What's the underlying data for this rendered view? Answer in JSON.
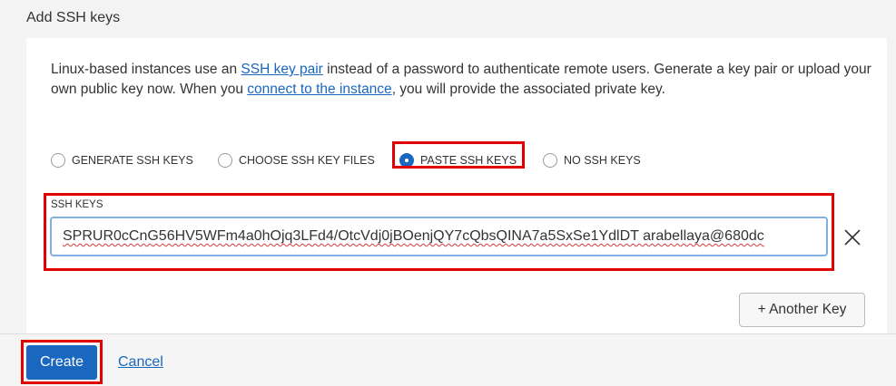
{
  "section": {
    "title": "Add SSH keys"
  },
  "description": {
    "part1": "Linux-based instances use an ",
    "link1": "SSH key pair",
    "part2": " instead of a password to authenticate remote users. Generate a key pair or upload your own public key now. When you ",
    "link2": "connect to the instance",
    "part3": ", you will provide the associated private key."
  },
  "ssh_options": [
    {
      "label": "GENERATE SSH KEYS",
      "selected": false
    },
    {
      "label": "CHOOSE SSH KEY FILES",
      "selected": false
    },
    {
      "label": "PASTE SSH KEYS",
      "selected": true
    },
    {
      "label": "NO SSH KEYS",
      "selected": false
    }
  ],
  "ssh_keys": {
    "label": "SSH KEYS",
    "value": "SPRUR0cCnG56HV5WFm4a0hOjq3LFd4/OtcVdj0jBOenjQY7cQbsQINA7a5SxSe1YdlDT arabellaya@680dc"
  },
  "another_key_button": "+ Another Key",
  "footer": {
    "create_label": "Create",
    "cancel_label": "Cancel"
  },
  "colors": {
    "accent": "#1a67c0",
    "highlight": "#e00000"
  }
}
